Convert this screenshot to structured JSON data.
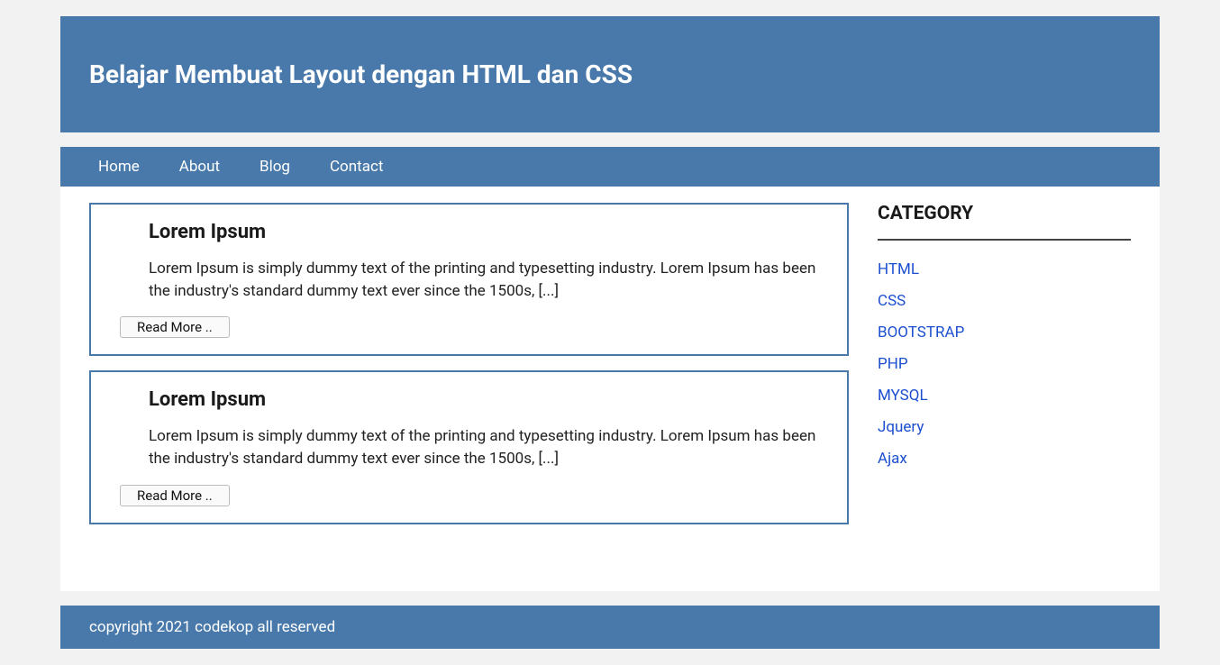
{
  "header": {
    "title": "Belajar Membuat Layout dengan HTML dan CSS"
  },
  "nav": {
    "items": [
      {
        "label": "Home"
      },
      {
        "label": "About"
      },
      {
        "label": "Blog"
      },
      {
        "label": "Contact"
      }
    ]
  },
  "articles": [
    {
      "title": "Lorem Ipsum",
      "excerpt": "Lorem Ipsum is simply dummy text of the printing and typesetting industry. Lorem Ipsum has been the industry's standard dummy text ever since the 1500s, [...]",
      "button_label": "Read More .."
    },
    {
      "title": "Lorem Ipsum",
      "excerpt": "Lorem Ipsum is simply dummy text of the printing and typesetting industry. Lorem Ipsum has been the industry's standard dummy text ever since the 1500s, [...]",
      "button_label": "Read More .."
    }
  ],
  "sidebar": {
    "title": "CATEGORY",
    "categories": [
      {
        "label": "HTML"
      },
      {
        "label": "CSS"
      },
      {
        "label": "BOOTSTRAP"
      },
      {
        "label": "PHP"
      },
      {
        "label": "MYSQL"
      },
      {
        "label": "Jquery"
      },
      {
        "label": "Ajax"
      }
    ]
  },
  "footer": {
    "text": "copyright 2021 codekop all reserved"
  }
}
